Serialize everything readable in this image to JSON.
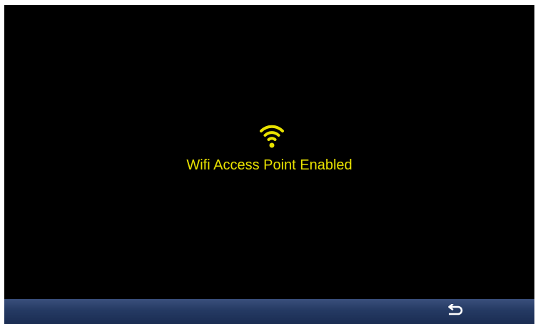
{
  "screen": {
    "message": "Wifi Access Point Enabled",
    "status_icon": "wifi-icon",
    "accent_color": "#e9e200",
    "background_color": "#000000"
  },
  "navigation_bar": {
    "back_icon": "back-arrow-icon",
    "bar_color": "#253a63"
  }
}
